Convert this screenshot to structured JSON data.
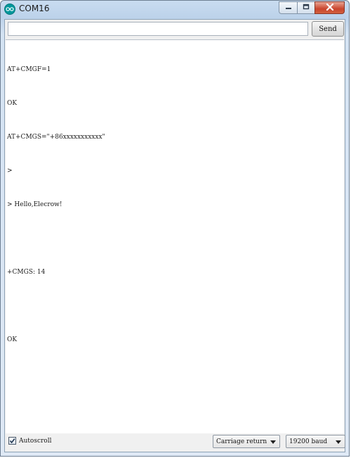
{
  "window": {
    "title": "COM16",
    "app_icon": "arduino-logo-icon",
    "minimize_icon": "minimize-icon",
    "maximize_icon": "maximize-icon",
    "close_icon": "close-icon"
  },
  "input": {
    "value": "",
    "send_label": "Send"
  },
  "output": {
    "lines": [
      "AT+CMGF=1",
      "OK",
      "AT+CMGS=\"+86xxxxxxxxxxx\"",
      ">",
      "> Hello,Elecrow!",
      "",
      "+CMGS: 14",
      "",
      "OK"
    ]
  },
  "footer": {
    "autoscroll_label": "Autoscroll",
    "autoscroll_checked": true,
    "line_ending": "Carriage return",
    "baud": "19200 baud"
  },
  "colors": {
    "arduino_teal": "#00979c",
    "close_red": "#c9452d"
  }
}
